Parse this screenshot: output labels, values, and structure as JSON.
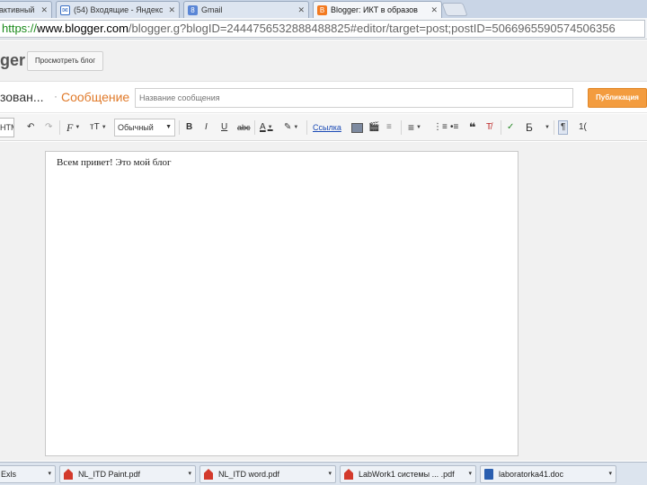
{
  "tabs": [
    {
      "label": "активный",
      "icon": "generic"
    },
    {
      "label": "(54) Входящие - Яндекс",
      "icon": "mail"
    },
    {
      "label": "Gmail",
      "icon": "gmail"
    },
    {
      "label": "Blogger: ИКТ в образов",
      "icon": "blogger",
      "active": true
    }
  ],
  "tab_close": "✕",
  "address": {
    "scheme": "https://",
    "host": "www.blogger.com",
    "path": "/blogger.g?blogID=2444756532888488825#editor/target=post;postID=5066965590574506356"
  },
  "header": {
    "logo": "ger",
    "view_blog": "Просмотреть блог"
  },
  "titlerow": {
    "blog_name": "зован...",
    "separator": "·",
    "post_type": "Сообщение",
    "title_placeholder": "Название сообщения",
    "publish": "Публикация"
  },
  "toolbar": {
    "mode": "HTML",
    "format": "Обычный",
    "link": "Ссылка",
    "undo": "↶",
    "redo": "↷",
    "font": "F",
    "size": "тТ",
    "bold": "B",
    "italic": "I",
    "underline": "U",
    "strike": "abc",
    "text_color": "A",
    "highlight": "✎",
    "image": "",
    "video": "🎬",
    "jump": "≡",
    "align": "≡",
    "numbered": "⋮≡",
    "bulleted": "•≡",
    "quote": "❝",
    "clear": "T̸",
    "spell": "✓",
    "lang": "Б",
    "ltr": "¶",
    "more": "1("
  },
  "editor": {
    "content": "Всем привет! Это мой блог"
  },
  "downloads": [
    {
      "label": "Exls",
      "type": "generic"
    },
    {
      "label": "NL_ITD Paint.pdf",
      "type": "pdf"
    },
    {
      "label": "NL_ITD word.pdf",
      "type": "pdf"
    },
    {
      "label": "LabWork1 системы ... .pdf",
      "type": "pdf"
    },
    {
      "label": "laboratorka41.doc",
      "type": "doc"
    }
  ],
  "download_arrow": "▾",
  "colors": {
    "accent": "#e07a2a",
    "publish": "#f39c3f",
    "link": "#1a4ab5"
  }
}
